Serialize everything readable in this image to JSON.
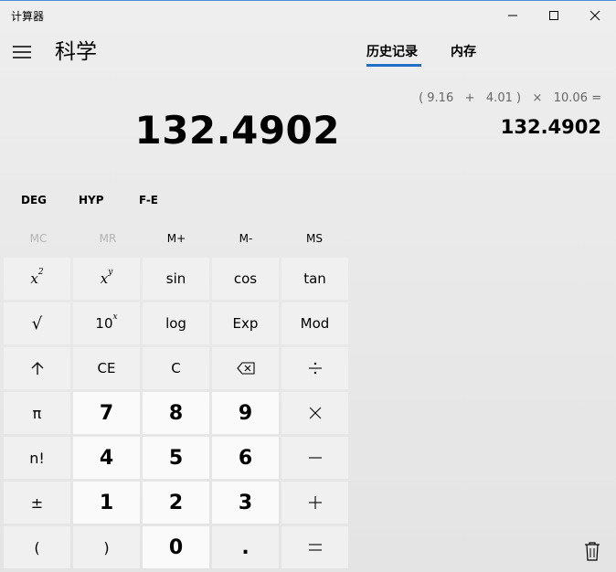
{
  "window": {
    "title": "计算器"
  },
  "header": {
    "mode": "科学"
  },
  "tabs": [
    {
      "label": "历史记录",
      "active": true
    },
    {
      "label": "内存",
      "active": false
    }
  ],
  "display": {
    "value": "132.4902"
  },
  "history": {
    "expression": "( 9.16   +   4.01 )   ×   10.06 =",
    "result": "132.4902"
  },
  "angle_row": {
    "deg": "DEG",
    "hyp": "HYP",
    "fe": "F-E"
  },
  "memory_row": {
    "mc": "MC",
    "mr": "MR",
    "mplus": "M+",
    "mminus": "M-",
    "ms": "MS"
  },
  "keys": {
    "x2": {
      "base": "x",
      "sup": "2"
    },
    "xy": {
      "base": "x",
      "sup": "y"
    },
    "sin": "sin",
    "cos": "cos",
    "tan": "tan",
    "sqrt": "√",
    "tenx": {
      "base": "10",
      "sup": "x"
    },
    "log": "log",
    "exp": "Exp",
    "mod": "Mod",
    "ce": "CE",
    "c": "C",
    "pi": "π",
    "fact": "n!",
    "pm": "±",
    "lparen": "(",
    "rparen": ")",
    "d0": "0",
    "d1": "1",
    "d2": "2",
    "d3": "3",
    "d4": "4",
    "d5": "5",
    "d6": "6",
    "d7": "7",
    "d8": "8",
    "d9": "9",
    "dot": "."
  },
  "colors": {
    "accent": "#1f6fc6",
    "num_key": "#fafafa",
    "fn_key": "#f0f0f0"
  }
}
